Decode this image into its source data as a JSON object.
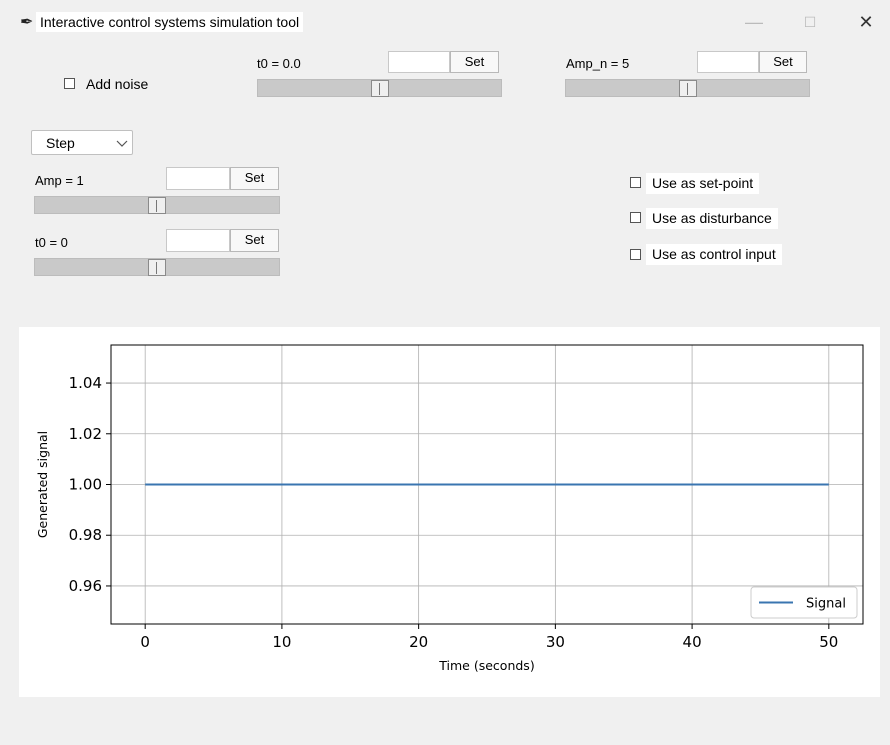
{
  "window": {
    "title": "Interactive control systems simulation tool",
    "minimize": "—",
    "maximize": "☐",
    "close": "✕"
  },
  "noise": {
    "add_noise_label": "Add noise",
    "t0_label": "t0 = 0.0",
    "t0_value": "",
    "t0_set": "Set",
    "t0_slider": 0.5,
    "amp_n_label": "Amp_n = 5",
    "amp_n_value": "",
    "amp_n_set": "Set",
    "amp_n_slider": 0.5
  },
  "signal": {
    "type_selected": "Step",
    "amp_label": "Amp = 1",
    "amp_value": "",
    "amp_set": "Set",
    "amp_slider": 0.5,
    "t0_label": "t0 = 0",
    "t0_value": "",
    "t0_set": "Set",
    "t0_slider": 0.5
  },
  "usage": {
    "setpoint_label": "Use as set-point",
    "disturbance_label": "Use as disturbance",
    "control_input_label": "Use as control input"
  },
  "chart_data": {
    "type": "line",
    "xlabel": "Time (seconds)",
    "ylabel": "Generated signal",
    "xlim": [
      -2.5,
      52.5
    ],
    "ylim": [
      0.945,
      1.055
    ],
    "xticks": [
      0,
      10,
      20,
      30,
      40,
      50
    ],
    "yticks": [
      0.96,
      0.98,
      1.0,
      1.02,
      1.04
    ],
    "ytick_labels": [
      "0.96",
      "0.98",
      "1.00",
      "1.02",
      "1.04"
    ],
    "grid": true,
    "legend_position": "lower right",
    "series": [
      {
        "name": "Signal",
        "color": "#3a75b0",
        "x": [
          0,
          50
        ],
        "y": [
          1.0,
          1.0
        ]
      }
    ]
  }
}
